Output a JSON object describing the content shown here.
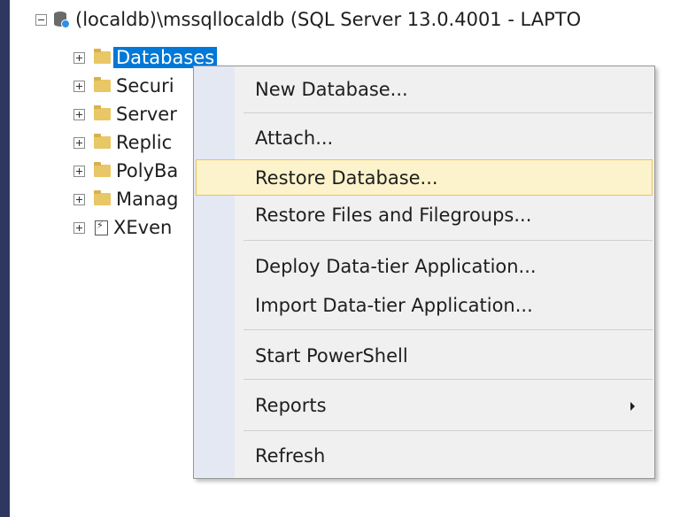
{
  "object_explorer": {
    "server_node": "(localdb)\\mssqllocaldb (SQL Server 13.0.4001 - LAPTO",
    "children": [
      {
        "label": "Databases"
      },
      {
        "label": "Securi"
      },
      {
        "label": "Server"
      },
      {
        "label": "Replic"
      },
      {
        "label": "PolyBa"
      },
      {
        "label": "Manag"
      },
      {
        "label": "XEven"
      }
    ]
  },
  "context_menu": {
    "items": [
      {
        "label": "New Database..."
      },
      {
        "label": "Attach..."
      },
      {
        "label": "Restore Database..."
      },
      {
        "label": "Restore Files and Filegroups..."
      },
      {
        "label": "Deploy Data-tier Application..."
      },
      {
        "label": "Import Data-tier Application..."
      },
      {
        "label": "Start PowerShell"
      },
      {
        "label": "Reports"
      },
      {
        "label": "Refresh"
      }
    ],
    "highlighted_item": "Restore Database..."
  },
  "colors": {
    "selection": "#0078d7",
    "menu_highlight": "#fcf3cc",
    "left_bar": "#2d3760"
  }
}
